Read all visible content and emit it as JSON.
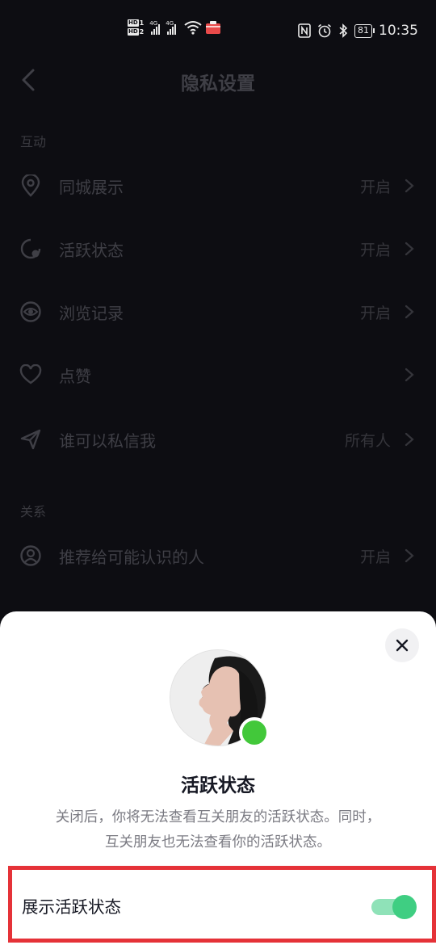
{
  "status_bar": {
    "hd1": "HD",
    "hd1_num": "1",
    "hd2": "HD",
    "hd2_num": "2",
    "net1": "4G",
    "net2": "4G",
    "battery": "81",
    "time": "10:35"
  },
  "header": {
    "title": "隐私设置"
  },
  "sections": [
    {
      "title": "互动",
      "items": [
        {
          "icon": "location-pin-icon",
          "label": "同城展示",
          "value": "开启"
        },
        {
          "icon": "active-status-icon",
          "label": "活跃状态",
          "value": "开启"
        },
        {
          "icon": "eye-icon",
          "label": "浏览记录",
          "value": "开启"
        },
        {
          "icon": "heart-icon",
          "label": "点赞",
          "value": ""
        },
        {
          "icon": "send-icon",
          "label": "谁可以私信我",
          "value": "所有人"
        }
      ]
    },
    {
      "title": "关系",
      "items": [
        {
          "icon": "user-circle-icon",
          "label": "推荐给可能认识的人",
          "value": "开启"
        }
      ]
    }
  ],
  "sheet": {
    "title": "活跃状态",
    "description_line1": "关闭后，你将无法查看互关朋友的活跃状态。同时，",
    "description_line2": "互关朋友也无法查看你的活跃状态。",
    "toggle_label": "展示活跃状态",
    "toggle_on": true
  },
  "colors": {
    "background": "#0d0d12",
    "sheet_bg": "#ffffff",
    "online_green": "#42c83a",
    "toggle_on": "#3fce82",
    "highlight_red": "#e53238"
  }
}
